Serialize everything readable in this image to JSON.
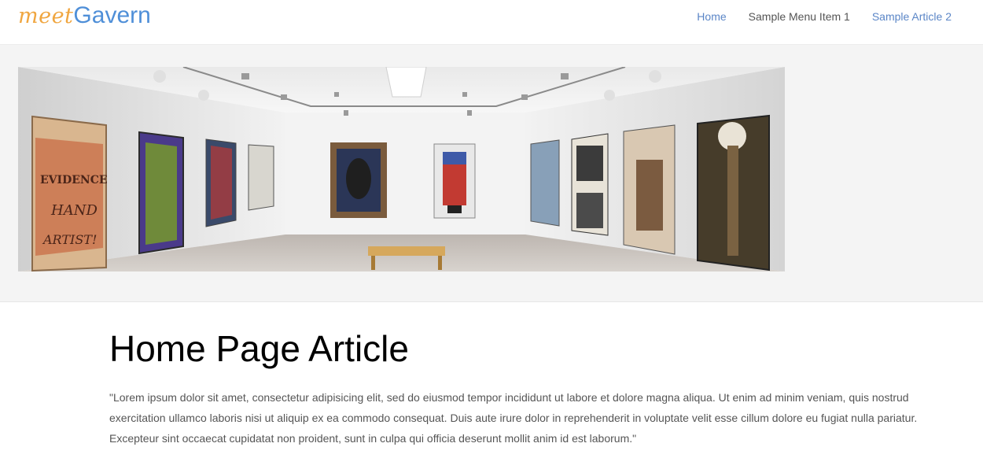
{
  "header": {
    "logo_prefix": "meet",
    "logo_main": "Gavern",
    "nav": [
      {
        "label": "Home",
        "color": "#5b86c7"
      },
      {
        "label": "Sample Menu Item 1",
        "color": "#555555"
      },
      {
        "label": "Sample Article 2",
        "color": "#5b86c7"
      }
    ]
  },
  "banner": {
    "painting_text": "EVIDENCE HAND ARTIST"
  },
  "article": {
    "title": "Home Page Article",
    "body": "\"Lorem ipsum dolor sit amet, consectetur adipisicing elit, sed do eiusmod tempor incididunt ut labore et dolore magna aliqua. Ut enim ad minim veniam, quis nostrud exercitation ullamco laboris nisi ut aliquip ex ea commodo consequat. Duis aute irure dolor in reprehenderit in voluptate velit esse cillum dolore eu fugiat nulla pariatur. Excepteur sint occaecat cupidatat non proident, sunt in culpa qui officia deserunt mollit anim id est laborum.\""
  },
  "colors": {
    "link_blue": "#5b86c7",
    "logo_orange": "#f0a640",
    "logo_blue": "#4f8fd8"
  }
}
